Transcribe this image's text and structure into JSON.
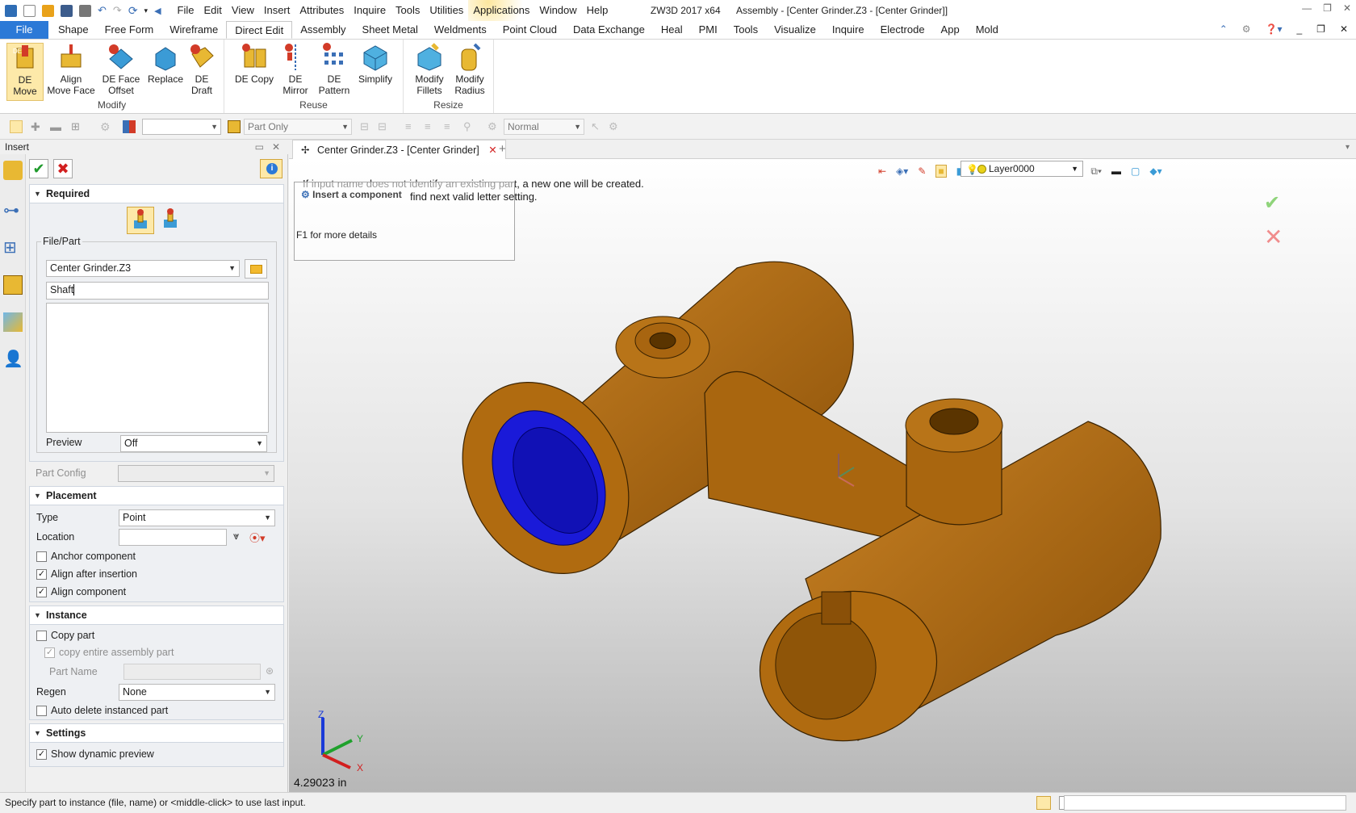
{
  "titlebar": {
    "menu": [
      "File",
      "Edit",
      "View",
      "Insert",
      "Attributes",
      "Inquire",
      "Tools",
      "Utilities",
      "Applications",
      "Window",
      "Help"
    ],
    "app": "ZW3D 2017  x64",
    "window_title": "Assembly - [Center Grinder.Z3 - [Center Grinder]]"
  },
  "ribbon_tabs": [
    "File",
    "Shape",
    "Free Form",
    "Wireframe",
    "Direct Edit",
    "Assembly",
    "Sheet Metal",
    "Weldments",
    "Point Cloud",
    "Data Exchange",
    "Heal",
    "PMI",
    "Tools",
    "Visualize",
    "Inquire",
    "Electrode",
    "App",
    "Mold"
  ],
  "active_tab": "Direct Edit",
  "ribbon": {
    "modify": {
      "label": "Modify",
      "buttons": [
        [
          "DE",
          "Move"
        ],
        [
          "Align",
          "Move Face"
        ],
        [
          "DE Face",
          "Offset"
        ],
        [
          "Replace",
          ""
        ],
        [
          "DE",
          "Draft"
        ]
      ]
    },
    "reuse": {
      "label": "Reuse",
      "buttons": [
        [
          "DE Copy",
          ""
        ],
        [
          "DE",
          "Mirror"
        ],
        [
          "DE",
          "Pattern"
        ],
        [
          "Simplify",
          ""
        ]
      ]
    },
    "resize": {
      "label": "Resize",
      "buttons": [
        [
          "Modify",
          "Fillets"
        ],
        [
          "Modify",
          "Radius"
        ]
      ]
    }
  },
  "toolbar2": {
    "filter": "Part Only",
    "render": "Normal"
  },
  "panel": {
    "title": "Insert",
    "required": {
      "header": "Required",
      "file_part_label": "File/Part",
      "file": "Center Grinder.Z3",
      "name": "Shaft",
      "preview_label": "Preview",
      "preview": "Off",
      "part_config_label": "Part Config"
    },
    "placement": {
      "header": "Placement",
      "type_label": "Type",
      "type": "Point",
      "location_label": "Location",
      "anchor": "Anchor component",
      "align_after": "Align after insertion",
      "align_component": "Align component"
    },
    "instance": {
      "header": "Instance",
      "copy_part": "Copy part",
      "copy_entire": "copy entire assembly part",
      "part_name": "Part  Name",
      "regen_label": "Regen",
      "regen": "None",
      "auto_delete": "Auto delete instanced part"
    },
    "settings": {
      "header": "Settings",
      "dynamic_preview": "Show dynamic preview"
    }
  },
  "document_tab": "Center Grinder.Z3 - [Center Grinder]",
  "viewport": {
    "hint_line1": "If input name does not identify an existing part, a new one will be created.",
    "hint_line2": "find next valid letter setting.",
    "popup_title": "Insert a component",
    "popup_help": "F1 for more details",
    "layer": "Layer0000",
    "measure": "4.29023 in",
    "axis_x": "X",
    "axis_y": "Y",
    "axis_z": "Z",
    "model_color": "#b06b10",
    "bore_color": "#1a1ad8"
  },
  "status": "Specify part to instance (file, name) or <middle-click> to use last input."
}
